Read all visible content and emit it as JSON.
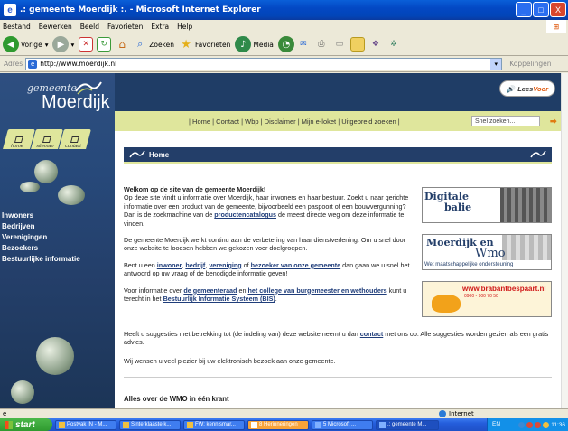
{
  "window": {
    "title": ".: gemeente Moerdijk :. - Microsoft Internet Explorer",
    "buttons": [
      "_",
      "□",
      "X"
    ]
  },
  "menubar": {
    "items": [
      "Bestand",
      "Bewerken",
      "Beeld",
      "Favorieten",
      "Extra",
      "Help"
    ]
  },
  "toolbar": {
    "back_label": "Vorige",
    "search_label": "Zoeken",
    "favorites_label": "Favorieten",
    "media_label": "Media"
  },
  "addressbar": {
    "label": "Adres",
    "url": "http://www.moerdijk.nl",
    "links_label": "Koppelingen"
  },
  "site": {
    "logo_gemeente": "gemeente",
    "logo_name": "Moerdijk",
    "leesvoor_lees": "Lees",
    "leesvoor_voor": "Voor",
    "nav_links": "| Home | Contact | Wbp | Disclaimer | Mijn e-loket | Uitgebreid zoeken |",
    "search_placeholder": "Snel zoeken...",
    "shortcuts": [
      "home",
      "sitemap",
      "contact"
    ],
    "sidenav": [
      "Inwoners",
      "Bedrijven",
      "Verenigingen",
      "Bezoekers",
      "Bestuurlijke informatie"
    ],
    "section_title": "Home",
    "welcome_heading": "Welkom op de site van de gemeente Moerdijk!",
    "p1_text": "Op deze site vindt u informatie over Moerdijk, haar inwoners en haar bestuur. Zoekt u naar gerichte informatie over een product van de gemeente, bijvoorbeeld een paspoort of een bouwvergunning? Dan is de zoekmachine van de ",
    "p1_link": "productencatalogus",
    "p1_end": " de meest directe weg om deze informatie te vinden.",
    "p2": "De gemeente Moerdijk werkt continu aan de verbetering van haar dienstverlening. Om u snel door onze website te loodsen hebben we gekozen voor doelgroepen.",
    "p3_a": "Bent u een ",
    "p3_l1": "inwoner",
    "p3_l2": "bedrijf",
    "p3_l3": "vereniging",
    "p3_of": " of ",
    "p3_l4": "bezoeker van onze gemeente",
    "p3_end": " dan gaan we u snel het antwoord op uw vraag of de benodigde informatie geven!",
    "p4_a": "Voor informatie over ",
    "p4_l1": "de gemeenteraad",
    "p4_en": " en ",
    "p4_l2": "het college van burgemeester en wethouders",
    "p4_b": " kunt u terecht in het ",
    "p4_l3": "Bestuurlijk Informatie Systeem (BIS)",
    "p5_a": "Heeft u suggesties met betrekking tot (de indeling van) deze website neemt u dan ",
    "p5_link": "contact",
    "p5_end": " met ons op. Alle suggesties worden gezien als een gratis advies.",
    "p6": "Wij wensen u veel plezier bij uw elektronisch bezoek aan onze gemeente.",
    "bottom_title": "Alles over de WMO in één krant",
    "banner1_line1": "Digitale",
    "banner1_line2": "balie",
    "banner2_line1": "Moerdijk en",
    "banner2_line2": "Wmo",
    "banner2_line3": "Wet maatschappelijke ondersteuning",
    "banner3_title": "www.brabantbespaart.nl",
    "banner3_tel": "0900 - 900 70 50"
  },
  "statusbar": {
    "zone": "Internet"
  },
  "taskbar": {
    "start": "start",
    "tasks": [
      "Postvak IN - M...",
      "Sinterklaaste k...",
      "FW: kennismar...",
      "8 Herinneringen",
      "5 Microsoft ...",
      ".: gemeente M..."
    ],
    "lang": "EN",
    "clock": "11:36"
  }
}
